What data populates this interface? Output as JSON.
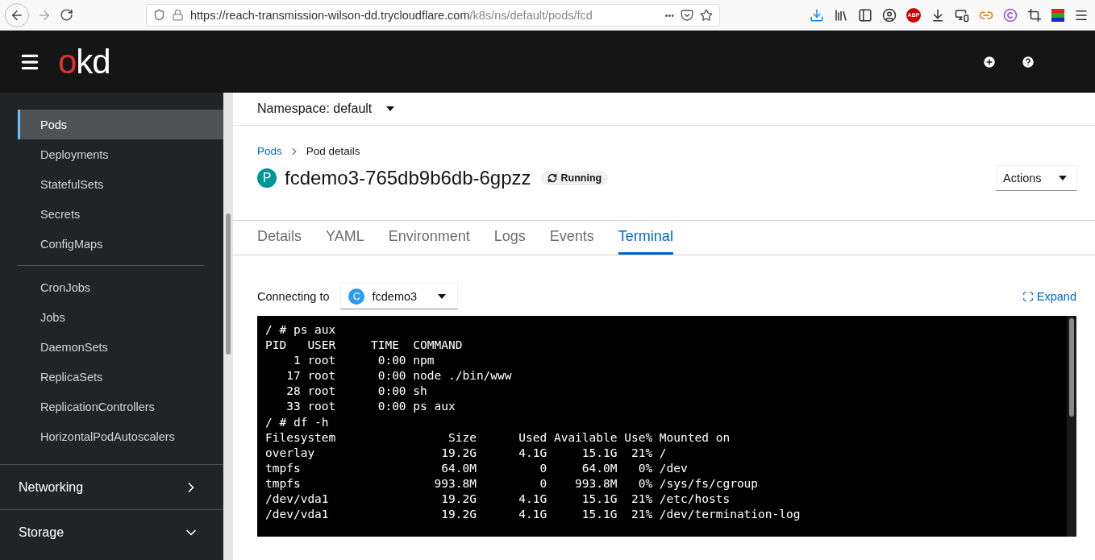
{
  "browser": {
    "url_host": "https://reach-transmission-wilson-dd.trycloudflare.com",
    "url_path": "/k8s/ns/default/pods/fcd",
    "more": "•••",
    "extensions": [
      {
        "kind": "download"
      },
      {
        "kind": "library"
      },
      {
        "kind": "sidebar"
      },
      {
        "kind": "account"
      },
      {
        "kind": "adblock",
        "label": "ABP"
      },
      {
        "kind": "save"
      },
      {
        "kind": "screen"
      },
      {
        "kind": "link"
      },
      {
        "kind": "copyright"
      },
      {
        "kind": "crop"
      },
      {
        "kind": "colors"
      },
      {
        "kind": "menu"
      }
    ]
  },
  "masthead": {
    "logo_accent": "o",
    "logo_rest": "kd"
  },
  "sidebar": {
    "groups": [
      {
        "items": [
          {
            "label": "Pods",
            "selected": true
          },
          {
            "label": "Deployments",
            "selected": false
          },
          {
            "label": "StatefulSets",
            "selected": false
          },
          {
            "label": "Secrets",
            "selected": false
          },
          {
            "label": "ConfigMaps",
            "selected": false
          }
        ]
      },
      {
        "items": [
          {
            "label": "CronJobs",
            "selected": false
          },
          {
            "label": "Jobs",
            "selected": false
          },
          {
            "label": "DaemonSets",
            "selected": false
          },
          {
            "label": "ReplicaSets",
            "selected": false
          },
          {
            "label": "ReplicationControllers",
            "selected": false
          },
          {
            "label": "HorizontalPodAutoscalers",
            "selected": false
          }
        ]
      }
    ],
    "sections": [
      {
        "label": "Networking",
        "expanded": false
      },
      {
        "label": "Storage",
        "expanded": true
      }
    ]
  },
  "namespace": {
    "label": "Namespace: default"
  },
  "breadcrumb": [
    {
      "label": "Pods",
      "link": true
    },
    {
      "label": "Pod details",
      "link": false
    }
  ],
  "pod": {
    "badge": "P",
    "name": "fcdemo3-765db9b6db-6gpzz",
    "status": "Running"
  },
  "actions": "Actions",
  "tabs": [
    {
      "label": "Details",
      "selected": false
    },
    {
      "label": "YAML",
      "selected": false
    },
    {
      "label": "Environment",
      "selected": false
    },
    {
      "label": "Logs",
      "selected": false
    },
    {
      "label": "Events",
      "selected": false
    },
    {
      "label": "Terminal",
      "selected": true
    }
  ],
  "terminal": {
    "connecting_label": "Connecting to",
    "container_badge": "C",
    "container": "fcdemo3",
    "expand": "Expand",
    "lines": [
      "/ # ps aux",
      "PID   USER     TIME  COMMAND",
      "    1 root      0:00 npm",
      "   17 root      0:00 node ./bin/www",
      "   28 root      0:00 sh",
      "   33 root      0:00 ps aux",
      "/ # df -h",
      "Filesystem                Size      Used Available Use% Mounted on",
      "overlay                  19.2G      4.1G     15.1G  21% /",
      "tmpfs                    64.0M         0     64.0M   0% /dev",
      "tmpfs                   993.8M         0    993.8M   0% /sys/fs/cgroup",
      "/dev/vda1                19.2G      4.1G     15.1G  21% /etc/hosts",
      "/dev/vda1                19.2G      4.1G     15.1G  21% /dev/termination-log"
    ]
  }
}
